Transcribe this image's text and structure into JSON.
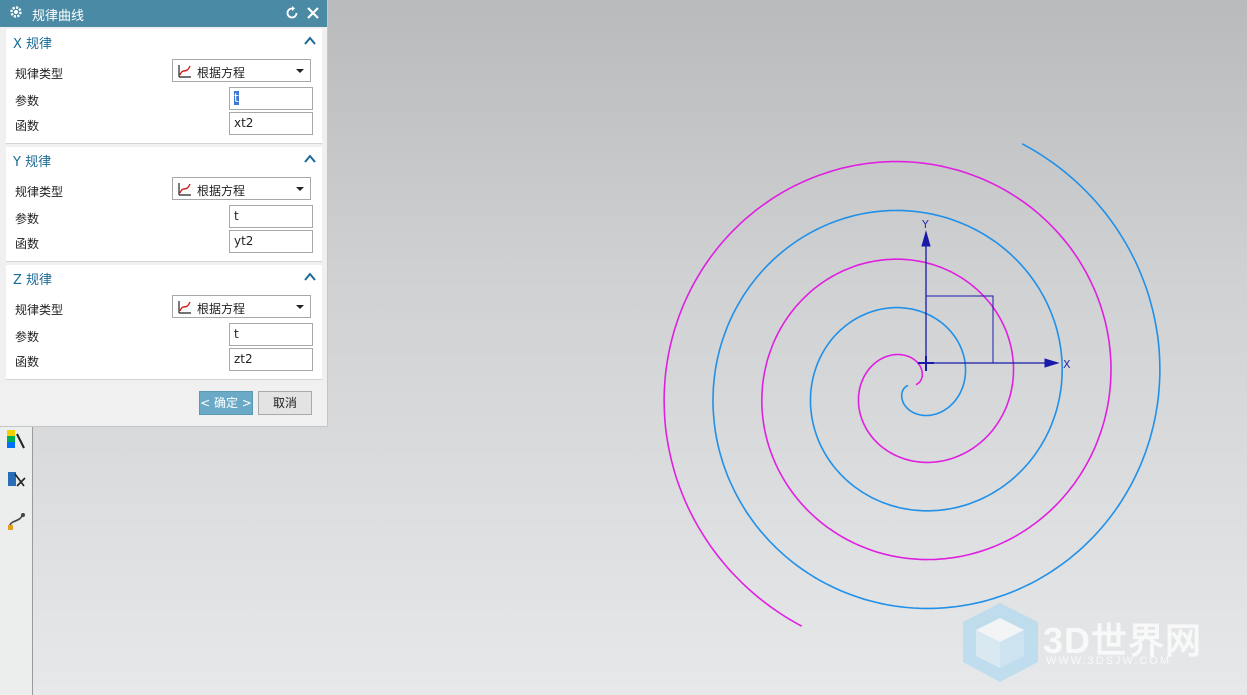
{
  "dialog": {
    "title": "规律曲线",
    "ok_label": "< 确定 >",
    "cancel_label": "取消"
  },
  "groups": [
    {
      "header": "X 规律",
      "type_label": "规律类型",
      "type_value": "根据方程",
      "param_label": "参数",
      "param_value": "t",
      "func_label": "函数",
      "func_value": "xt2"
    },
    {
      "header": "Y 规律",
      "type_label": "规律类型",
      "type_value": "根据方程",
      "param_label": "参数",
      "param_value": "t",
      "func_label": "函数",
      "func_value": "yt2"
    },
    {
      "header": "Z 规律",
      "type_label": "规律类型",
      "type_value": "根据方程",
      "param_label": "参数",
      "param_value": "t",
      "func_label": "函数",
      "func_value": "zt2"
    }
  ],
  "canvas": {
    "axis_x_label": "X",
    "axis_y_label": "Y",
    "curve_colors": {
      "magenta": "#e020e0",
      "blue": "#2090e8"
    },
    "axis_color": "#1a1aa8"
  },
  "watermark": {
    "text": "3D世界网",
    "sub": "WWW.3DSJW.COM"
  },
  "colors": {
    "title_bar": "#4a8aa5",
    "group_header": "#1a6a95",
    "ok_button": "#6aaac6"
  }
}
